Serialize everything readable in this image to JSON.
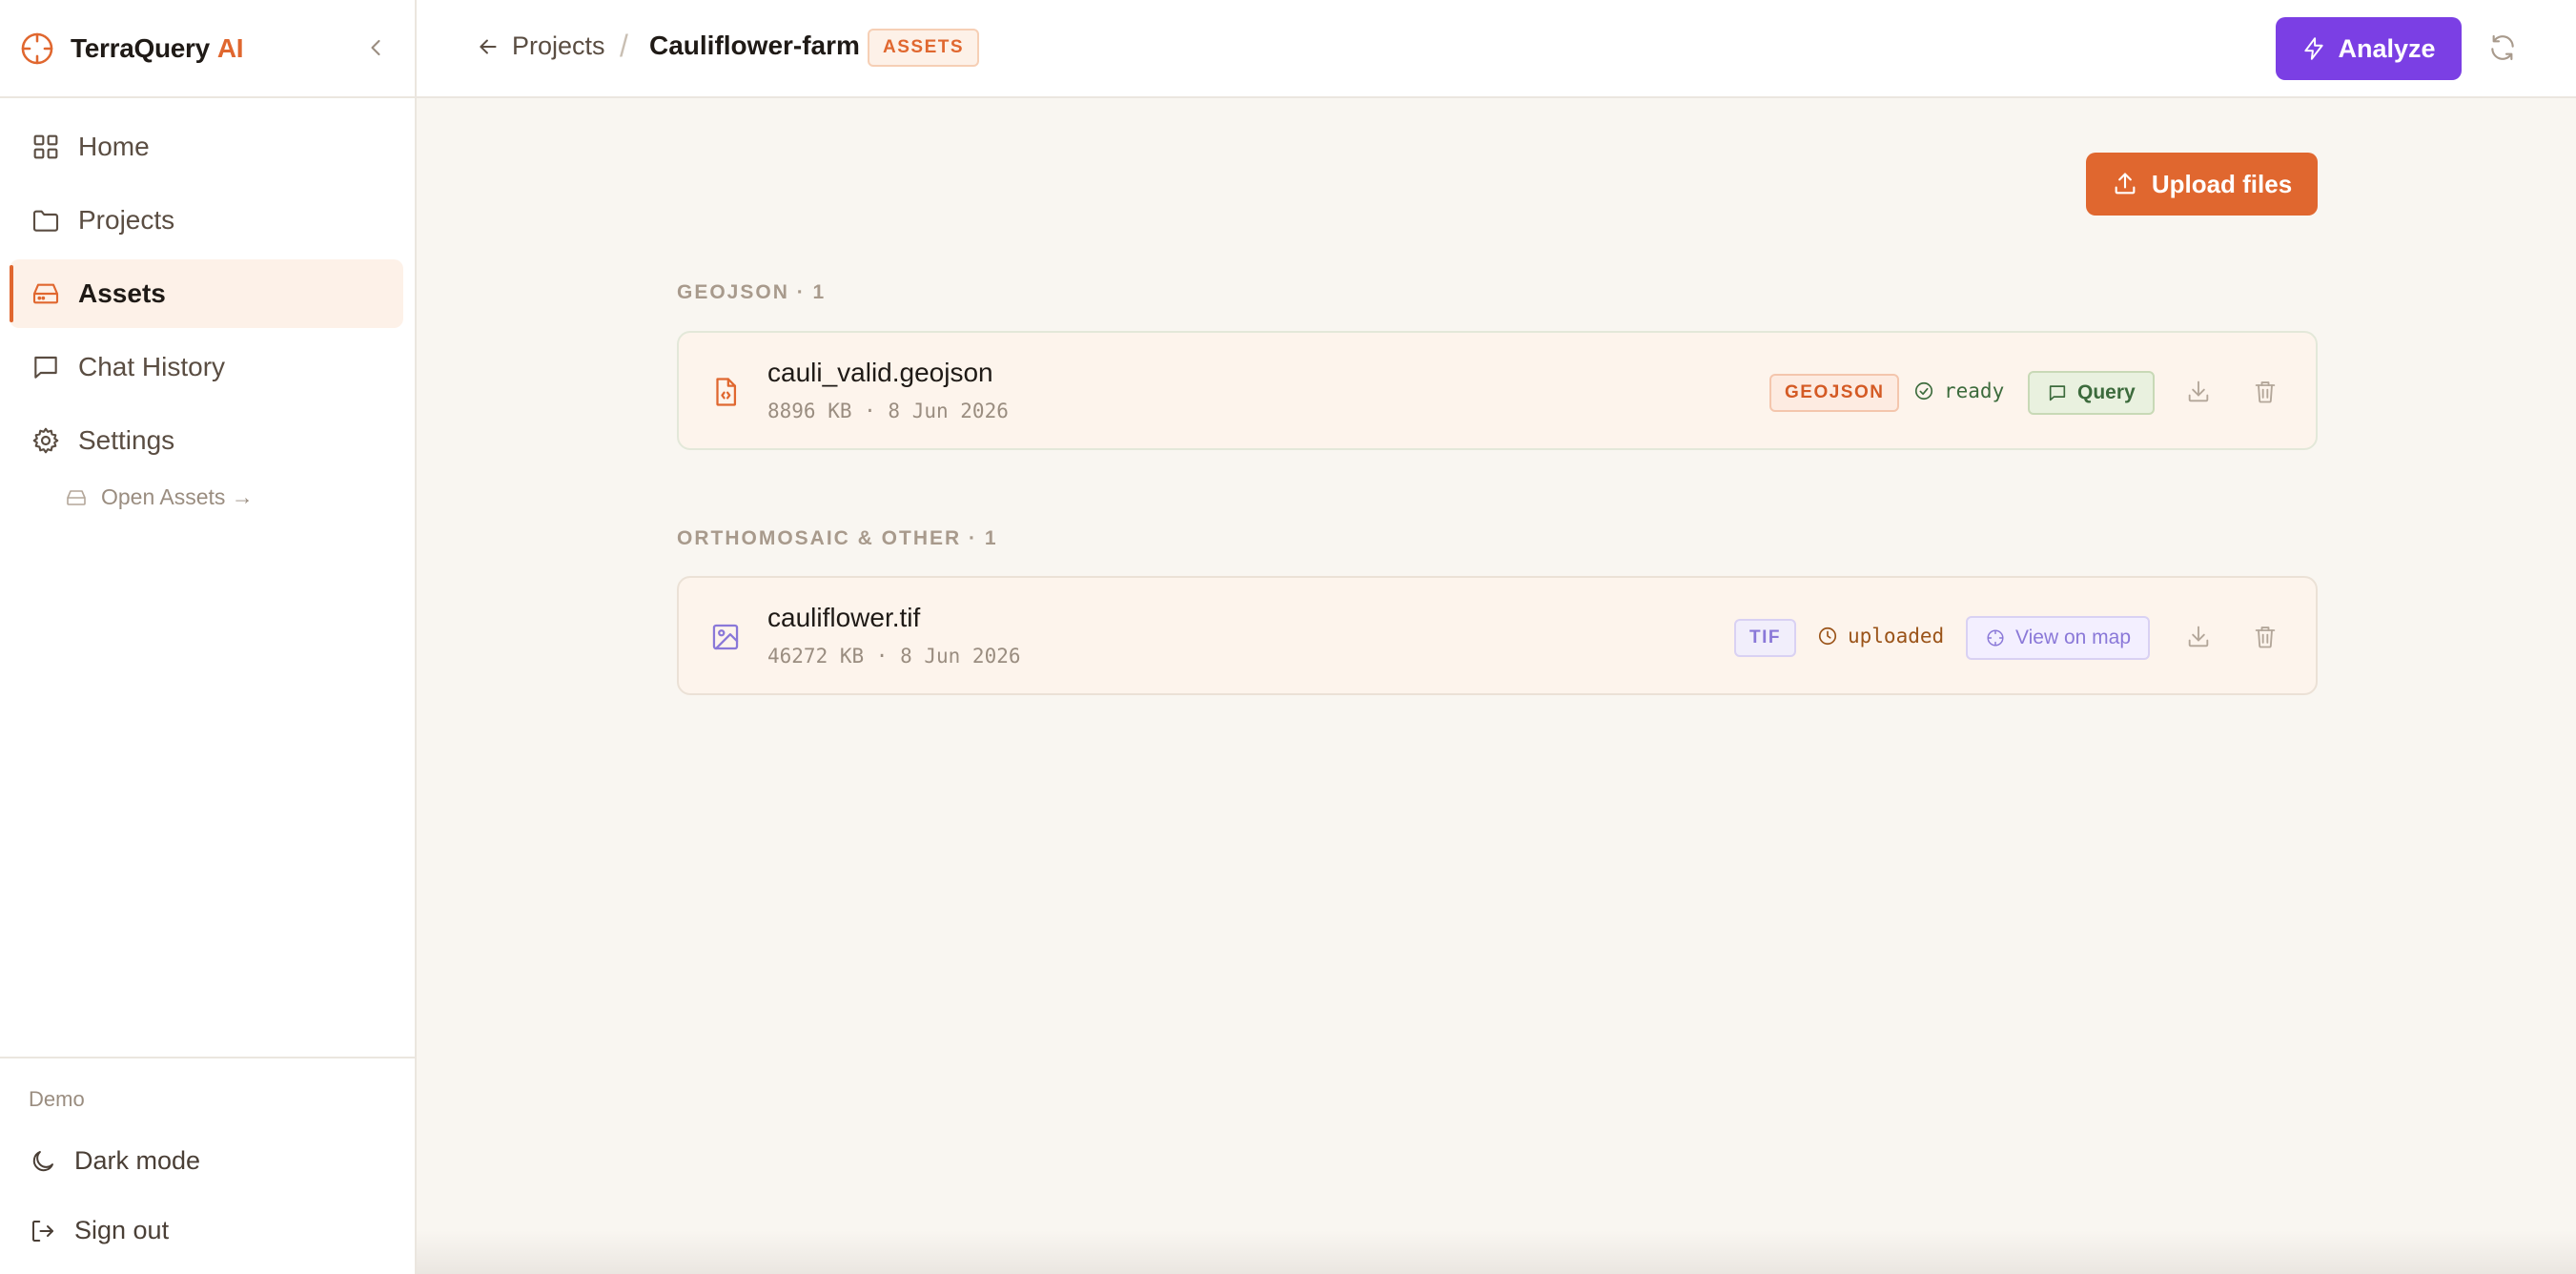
{
  "app": {
    "brand_name": "TerraQuery",
    "brand_suffix": "AI",
    "accent_color": "#e0672f",
    "primary_color": "#7b3fe4"
  },
  "sidebar": {
    "items": [
      {
        "label": "Home",
        "icon": "grid-icon",
        "active": false
      },
      {
        "label": "Projects",
        "icon": "folder-icon",
        "active": false
      },
      {
        "label": "Assets",
        "icon": "drive-icon",
        "active": true
      },
      {
        "label": "Chat History",
        "icon": "message-icon",
        "active": false
      },
      {
        "label": "Settings",
        "icon": "gear-icon",
        "active": false
      }
    ],
    "sub_link": "Open Assets →",
    "footer_label": "Demo",
    "dark_mode_label": "Dark mode",
    "sign_out_label": "Sign out"
  },
  "header": {
    "back_label": "Projects",
    "separator": "/",
    "project_name": "Cauliflower-farm",
    "badge": "ASSETS",
    "analyze_label": "Analyze"
  },
  "main": {
    "upload_label": "Upload files",
    "groups": [
      {
        "label": "GEOJSON · 1",
        "assets": [
          {
            "name": "cauli_valid.geojson",
            "meta": "8896 KB · 8 Jun 2026",
            "type": "GEOJSON",
            "status": "ready",
            "action": "Query",
            "icon": "code-file-icon"
          }
        ]
      },
      {
        "label": "ORTHOMOSAIC & OTHER · 1",
        "assets": [
          {
            "name": "cauliflower.tif",
            "meta": "46272 KB · 8 Jun 2026",
            "type": "TIF",
            "status": "uploaded",
            "action": "View on map",
            "icon": "image-icon"
          }
        ]
      }
    ]
  }
}
